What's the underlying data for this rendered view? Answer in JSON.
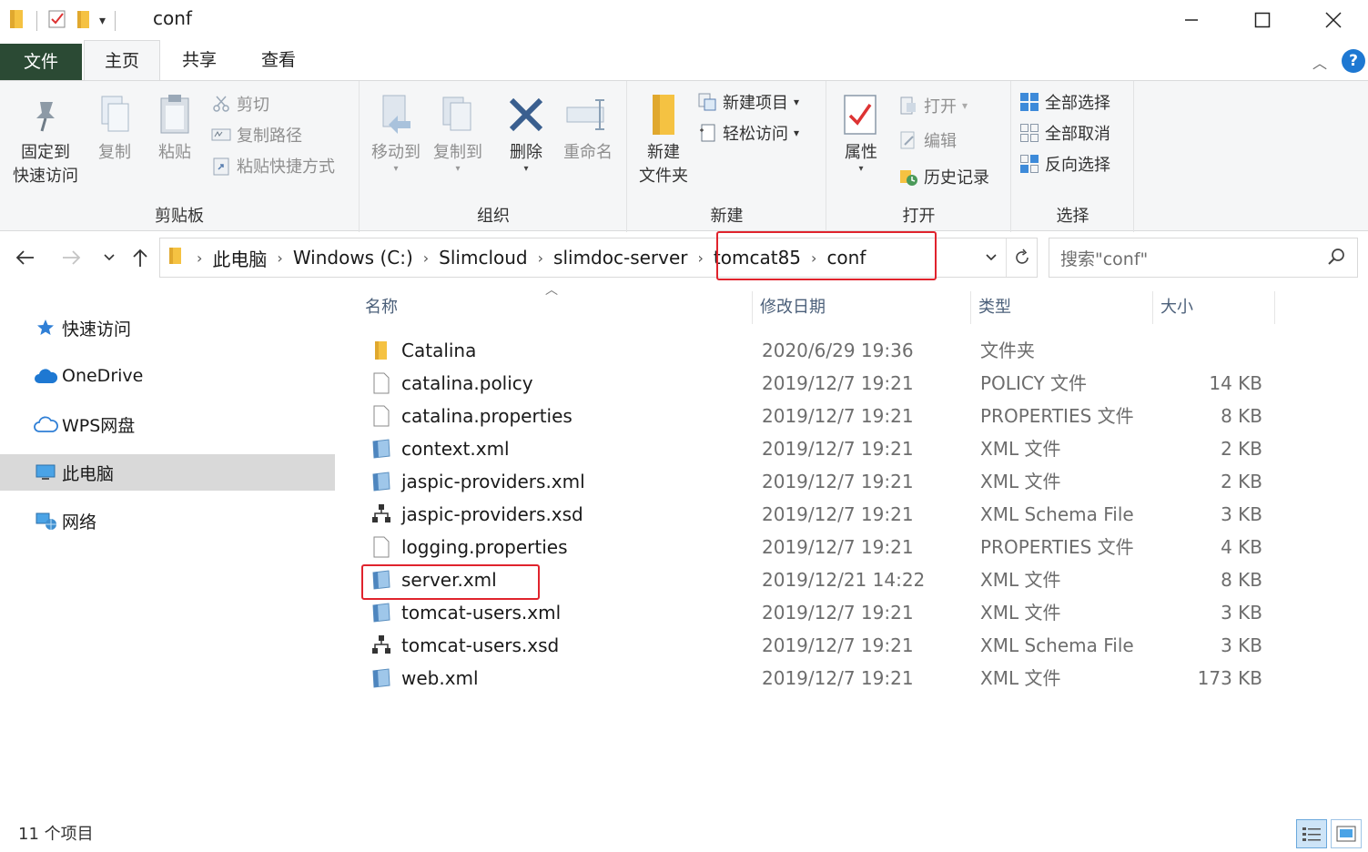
{
  "window": {
    "title": "conf",
    "minimize": "—",
    "maximize": "☐",
    "close": "✕"
  },
  "tabs": {
    "file": "文件",
    "home": "主页",
    "share": "共享",
    "view": "查看"
  },
  "ribbon": {
    "clipboard": {
      "label": "剪贴板",
      "pin_line1": "固定到",
      "pin_line2": "快速访问",
      "copy": "复制",
      "paste": "粘贴",
      "cut": "剪切",
      "copy_path": "复制路径",
      "paste_shortcut": "粘贴快捷方式"
    },
    "organize": {
      "label": "组织",
      "move_to": "移动到",
      "copy_to": "复制到",
      "delete": "删除",
      "rename": "重命名"
    },
    "new": {
      "label": "新建",
      "new_folder_line1": "新建",
      "new_folder_line2": "文件夹",
      "new_item": "新建项目",
      "easy_access": "轻松访问"
    },
    "open": {
      "label": "打开",
      "properties": "属性",
      "open": "打开",
      "edit": "编辑",
      "history": "历史记录"
    },
    "select": {
      "label": "选择",
      "select_all": "全部选择",
      "select_none": "全部取消",
      "invert": "反向选择"
    }
  },
  "address": {
    "crumbs": [
      "此电脑",
      "Windows (C:)",
      "Slimcloud",
      "slimdoc-server",
      "tomcat85",
      "conf"
    ],
    "search_placeholder": "搜索\"conf\""
  },
  "sidebar": {
    "items": [
      {
        "label": "快速访问"
      },
      {
        "label": "OneDrive"
      },
      {
        "label": "WPS网盘"
      },
      {
        "label": "此电脑"
      },
      {
        "label": "网络"
      }
    ]
  },
  "columns": {
    "name": "名称",
    "date": "修改日期",
    "type": "类型",
    "size": "大小"
  },
  "files": [
    {
      "name": "Catalina",
      "date": "2020/6/29 19:36",
      "type": "文件夹",
      "size": "",
      "icon": "folder"
    },
    {
      "name": "catalina.policy",
      "date": "2019/12/7 19:21",
      "type": "POLICY 文件",
      "size": "14 KB",
      "icon": "file"
    },
    {
      "name": "catalina.properties",
      "date": "2019/12/7 19:21",
      "type": "PROPERTIES 文件",
      "size": "8 KB",
      "icon": "file"
    },
    {
      "name": "context.xml",
      "date": "2019/12/7 19:21",
      "type": "XML 文件",
      "size": "2 KB",
      "icon": "xml"
    },
    {
      "name": "jaspic-providers.xml",
      "date": "2019/12/7 19:21",
      "type": "XML 文件",
      "size": "2 KB",
      "icon": "xml"
    },
    {
      "name": "jaspic-providers.xsd",
      "date": "2019/12/7 19:21",
      "type": "XML Schema File",
      "size": "3 KB",
      "icon": "xsd"
    },
    {
      "name": "logging.properties",
      "date": "2019/12/7 19:21",
      "type": "PROPERTIES 文件",
      "size": "4 KB",
      "icon": "file"
    },
    {
      "name": "server.xml",
      "date": "2019/12/21 14:22",
      "type": "XML 文件",
      "size": "8 KB",
      "icon": "xml"
    },
    {
      "name": "tomcat-users.xml",
      "date": "2019/12/7 19:21",
      "type": "XML 文件",
      "size": "3 KB",
      "icon": "xml"
    },
    {
      "name": "tomcat-users.xsd",
      "date": "2019/12/7 19:21",
      "type": "XML Schema File",
      "size": "3 KB",
      "icon": "xsd"
    },
    {
      "name": "web.xml",
      "date": "2019/12/7 19:21",
      "type": "XML 文件",
      "size": "173 KB",
      "icon": "xml"
    }
  ],
  "status": {
    "item_count": "11 个项目"
  },
  "colors": {
    "file_tab": "#2b4a34",
    "highlight": "#e0232d",
    "folder": "#f5c242",
    "accent": "#1e78d2"
  }
}
